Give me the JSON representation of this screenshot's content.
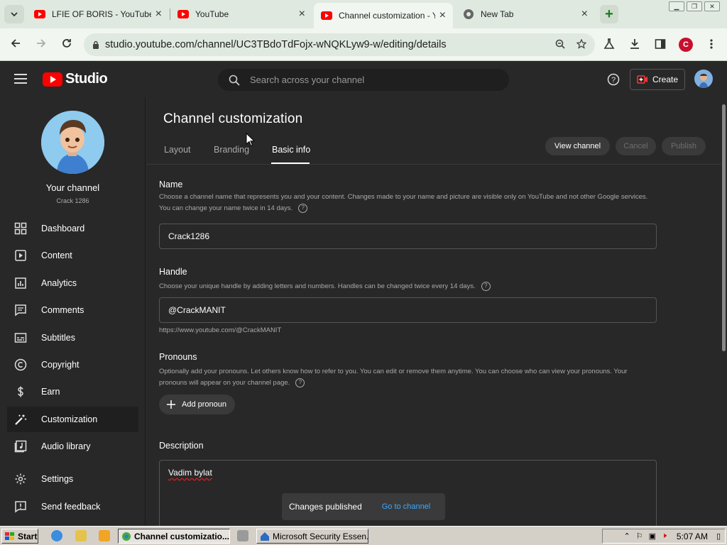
{
  "browser": {
    "tabs": [
      {
        "title": "LFIE OF BORIS - YouTube",
        "close": "×"
      },
      {
        "title": "YouTube",
        "close": "×"
      },
      {
        "title": "Channel customization - Yo",
        "close": "×"
      },
      {
        "title": "New Tab",
        "close": "×"
      }
    ],
    "new_tab": "+",
    "url": "studio.youtube.com/channel/UC3TBdoTdFojx-wNQKLyw9-w/editing/details",
    "profile_initial": "C"
  },
  "studio": {
    "logo_text": "Studio",
    "search_placeholder": "Search across your channel",
    "create_label": "Create",
    "help_glyph": "?"
  },
  "sidebar": {
    "your_channel": "Your channel",
    "handle": "Crack 1286",
    "items": [
      {
        "label": "Dashboard",
        "icon": "dashboard-icon"
      },
      {
        "label": "Content",
        "icon": "content-icon"
      },
      {
        "label": "Analytics",
        "icon": "analytics-icon"
      },
      {
        "label": "Comments",
        "icon": "comments-icon"
      },
      {
        "label": "Subtitles",
        "icon": "subtitles-icon"
      },
      {
        "label": "Copyright",
        "icon": "copyright-icon"
      },
      {
        "label": "Earn",
        "icon": "earn-icon"
      },
      {
        "label": "Customization",
        "icon": "customization-icon",
        "active": true
      },
      {
        "label": "Audio library",
        "icon": "audio-library-icon"
      },
      {
        "label": "Settings",
        "icon": "settings-icon"
      },
      {
        "label": "Send feedback",
        "icon": "feedback-icon"
      }
    ]
  },
  "main": {
    "title": "Channel customization",
    "tabs": [
      "Layout",
      "Branding",
      "Basic info"
    ],
    "active_tab": "Basic info",
    "buttons": {
      "view_channel": "View channel",
      "cancel": "Cancel",
      "publish": "Publish"
    },
    "name": {
      "label": "Name",
      "description": "Choose a channel name that represents you and your content. Changes made to your name and picture are visible only on YouTube and not other Google services. You can change your name twice in 14 days.",
      "value": "Crack1286"
    },
    "handle": {
      "label": "Handle",
      "description": "Choose your unique handle by adding letters and numbers. Handles can be changed twice every 14 days.",
      "value": "@CrackMANIT",
      "url": "https://www.youtube.com/@CrackMANIT"
    },
    "pronouns": {
      "label": "Pronouns",
      "description": "Optionally add your pronouns. Let others know how to refer to you. You can edit or remove them anytime. You can choose who can view your pronouns. Your pronouns will appear on your channel page.",
      "add_label": "Add pronoun"
    },
    "description": {
      "label": "Description",
      "value": "Vadim bylat"
    }
  },
  "toast": {
    "message": "Changes published",
    "link": "Go to channel"
  },
  "taskbar": {
    "start": "Start",
    "windows": [
      "Channel customizatio...",
      "Microsoft Security Essen..."
    ],
    "clock": "5:07 AM"
  },
  "colors": {
    "accent_red": "#ff0000",
    "link_blue": "#3ea6ff",
    "background": "#282828"
  }
}
